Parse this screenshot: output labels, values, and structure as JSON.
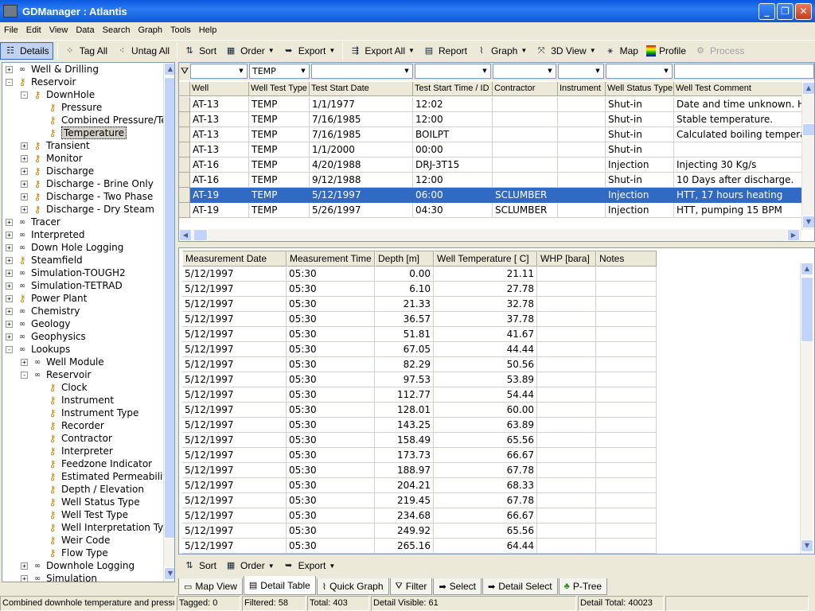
{
  "window": {
    "title": "GDManager : Atlantis"
  },
  "menu": [
    "File",
    "Edit",
    "View",
    "Data",
    "Search",
    "Graph",
    "Tools",
    "Help"
  ],
  "toolbar": {
    "details": "Details",
    "tag_all": "Tag All",
    "untag_all": "Untag All",
    "sort": "Sort",
    "order": "Order",
    "export": "Export",
    "export_all": "Export All",
    "report": "Report",
    "graph": "Graph",
    "view3d": "3D View",
    "map": "Map",
    "profile": "Profile",
    "process": "Process"
  },
  "tree": [
    {
      "label": "Well & Drilling",
      "level": 0,
      "exp": "+",
      "icon": "glasses"
    },
    {
      "label": "Reservoir",
      "level": 0,
      "exp": "-",
      "icon": "key"
    },
    {
      "label": "DownHole",
      "level": 1,
      "exp": "-",
      "icon": "key"
    },
    {
      "label": "Pressure",
      "level": 2,
      "exp": "",
      "icon": "key"
    },
    {
      "label": "Combined Pressure/Te",
      "level": 2,
      "exp": "",
      "icon": "key"
    },
    {
      "label": "Temperature",
      "level": 2,
      "exp": "",
      "icon": "key",
      "selected": true
    },
    {
      "label": "Transient",
      "level": 1,
      "exp": "+",
      "icon": "key"
    },
    {
      "label": "Monitor",
      "level": 1,
      "exp": "+",
      "icon": "key"
    },
    {
      "label": "Discharge",
      "level": 1,
      "exp": "+",
      "icon": "key"
    },
    {
      "label": "Discharge - Brine Only",
      "level": 1,
      "exp": "+",
      "icon": "key"
    },
    {
      "label": "Discharge - Two Phase",
      "level": 1,
      "exp": "+",
      "icon": "key"
    },
    {
      "label": "Discharge - Dry Steam",
      "level": 1,
      "exp": "+",
      "icon": "key"
    },
    {
      "label": "Tracer",
      "level": 0,
      "exp": "+",
      "icon": "glasses"
    },
    {
      "label": "Interpreted",
      "level": 0,
      "exp": "+",
      "icon": "glasses"
    },
    {
      "label": "Down Hole Logging",
      "level": 0,
      "exp": "+",
      "icon": "glasses"
    },
    {
      "label": "Steamfield",
      "level": 0,
      "exp": "+",
      "icon": "key"
    },
    {
      "label": "Simulation-TOUGH2",
      "level": 0,
      "exp": "+",
      "icon": "glasses"
    },
    {
      "label": "Simulation-TETRAD",
      "level": 0,
      "exp": "+",
      "icon": "glasses"
    },
    {
      "label": "Power Plant",
      "level": 0,
      "exp": "+",
      "icon": "key"
    },
    {
      "label": "Chemistry",
      "level": 0,
      "exp": "+",
      "icon": "glasses"
    },
    {
      "label": "Geology",
      "level": 0,
      "exp": "+",
      "icon": "glasses"
    },
    {
      "label": "Geophysics",
      "level": 0,
      "exp": "+",
      "icon": "glasses"
    },
    {
      "label": "Lookups",
      "level": 0,
      "exp": "-",
      "icon": "glasses"
    },
    {
      "label": "Well Module",
      "level": 1,
      "exp": "+",
      "icon": "glasses"
    },
    {
      "label": "Reservoir",
      "level": 1,
      "exp": "-",
      "icon": "glasses"
    },
    {
      "label": "Clock",
      "level": 2,
      "exp": "",
      "icon": "key"
    },
    {
      "label": "Instrument",
      "level": 2,
      "exp": "",
      "icon": "key"
    },
    {
      "label": "Instrument Type",
      "level": 2,
      "exp": "",
      "icon": "key"
    },
    {
      "label": "Recorder",
      "level": 2,
      "exp": "",
      "icon": "key"
    },
    {
      "label": "Contractor",
      "level": 2,
      "exp": "",
      "icon": "key"
    },
    {
      "label": "Interpreter",
      "level": 2,
      "exp": "",
      "icon": "key"
    },
    {
      "label": "Feedzone Indicator",
      "level": 2,
      "exp": "",
      "icon": "key"
    },
    {
      "label": "Estimated Permeability",
      "level": 2,
      "exp": "",
      "icon": "key"
    },
    {
      "label": "Depth / Elevation",
      "level": 2,
      "exp": "",
      "icon": "key"
    },
    {
      "label": "Well Status Type",
      "level": 2,
      "exp": "",
      "icon": "key"
    },
    {
      "label": "Well Test Type",
      "level": 2,
      "exp": "",
      "icon": "key"
    },
    {
      "label": "Well Interpretation Ty",
      "level": 2,
      "exp": "",
      "icon": "key"
    },
    {
      "label": "Weir Code",
      "level": 2,
      "exp": "",
      "icon": "key"
    },
    {
      "label": "Flow Type",
      "level": 2,
      "exp": "",
      "icon": "key"
    },
    {
      "label": "Downhole Logging",
      "level": 1,
      "exp": "+",
      "icon": "glasses"
    },
    {
      "label": "Simulation",
      "level": 1,
      "exp": "+",
      "icon": "glasses"
    }
  ],
  "well_filter": {
    "test_type": "TEMP"
  },
  "well_columns": [
    "Well",
    "Well Test Type",
    "Test Start Date",
    "Test Start Time / ID",
    "Contractor",
    "Instrument",
    "Well Status Type",
    "Well Test Comment"
  ],
  "well_rows": [
    [
      "AT-13",
      "TEMP",
      "1/1/1977",
      "12:02",
      "",
      "",
      "Shut-in",
      "Date and time unknown. He"
    ],
    [
      "AT-13",
      "TEMP",
      "7/16/1985",
      "12:00",
      "",
      "",
      "Shut-in",
      "Stable temperature."
    ],
    [
      "AT-13",
      "TEMP",
      "7/16/1985",
      "BOILPT",
      "",
      "",
      "Shut-in",
      "Calculated boiling temperatu"
    ],
    [
      "AT-13",
      "TEMP",
      "1/1/2000",
      "00:00",
      "",
      "",
      "Shut-in",
      ""
    ],
    [
      "AT-16",
      "TEMP",
      "4/20/1988",
      "DRJ-3T15",
      "",
      "",
      "Injection",
      "Injecting 30 Kg/s"
    ],
    [
      "AT-16",
      "TEMP",
      "9/12/1988",
      "12:00",
      "",
      "",
      "Shut-in",
      "10 Days after discharge."
    ],
    [
      "AT-19",
      "TEMP",
      "5/12/1997",
      "06:00",
      "SCLUMBER",
      "",
      "Injection",
      "HTT, 17 hours heating"
    ],
    [
      "AT-19",
      "TEMP",
      "5/26/1997",
      "04:30",
      "SCLUMBER",
      "",
      "Injection",
      "HTT, pumping 15 BPM"
    ]
  ],
  "well_selected_index": 6,
  "detail_columns": [
    "Measurement Date",
    "Measurement Time",
    "Depth [m]",
    "Well Temperature [ C]",
    "WHP [bara]",
    "Notes"
  ],
  "detail_rows": [
    [
      "5/12/1997",
      "05:30",
      "0.00",
      "21.11"
    ],
    [
      "5/12/1997",
      "05:30",
      "6.10",
      "27.78"
    ],
    [
      "5/12/1997",
      "05:30",
      "21.33",
      "32.78"
    ],
    [
      "5/12/1997",
      "05:30",
      "36.57",
      "37.78"
    ],
    [
      "5/12/1997",
      "05:30",
      "51.81",
      "41.67"
    ],
    [
      "5/12/1997",
      "05:30",
      "67.05",
      "44.44"
    ],
    [
      "5/12/1997",
      "05:30",
      "82.29",
      "50.56"
    ],
    [
      "5/12/1997",
      "05:30",
      "97.53",
      "53.89"
    ],
    [
      "5/12/1997",
      "05:30",
      "112.77",
      "54.44"
    ],
    [
      "5/12/1997",
      "05:30",
      "128.01",
      "60.00"
    ],
    [
      "5/12/1997",
      "05:30",
      "143.25",
      "63.89"
    ],
    [
      "5/12/1997",
      "05:30",
      "158.49",
      "65.56"
    ],
    [
      "5/12/1997",
      "05:30",
      "173.73",
      "66.67"
    ],
    [
      "5/12/1997",
      "05:30",
      "188.97",
      "67.78"
    ],
    [
      "5/12/1997",
      "05:30",
      "204.21",
      "68.33"
    ],
    [
      "5/12/1997",
      "05:30",
      "219.45",
      "67.78"
    ],
    [
      "5/12/1997",
      "05:30",
      "234.68",
      "66.67"
    ],
    [
      "5/12/1997",
      "05:30",
      "249.92",
      "65.56"
    ],
    [
      "5/12/1997",
      "05:30",
      "265.16",
      "64.44"
    ]
  ],
  "bottom_toolbar": {
    "sort": "Sort",
    "order": "Order",
    "export": "Export"
  },
  "tabs": [
    "Map View",
    "Detail Table",
    "Quick Graph",
    "Filter",
    "Select",
    "Detail Select",
    "P-Tree"
  ],
  "active_tab": 1,
  "status": {
    "hint": "Combined downhole temperature and pressur",
    "tagged": "Tagged: 0",
    "filtered": "Filtered: 58",
    "total": "Total: 403",
    "detail_visible": "Detail Visible: 61",
    "detail_total": "Detail Total: 40023"
  },
  "colors": {
    "selection": "#316ac5",
    "titlebar": "#0a58e0",
    "chrome": "#ece9d8"
  }
}
